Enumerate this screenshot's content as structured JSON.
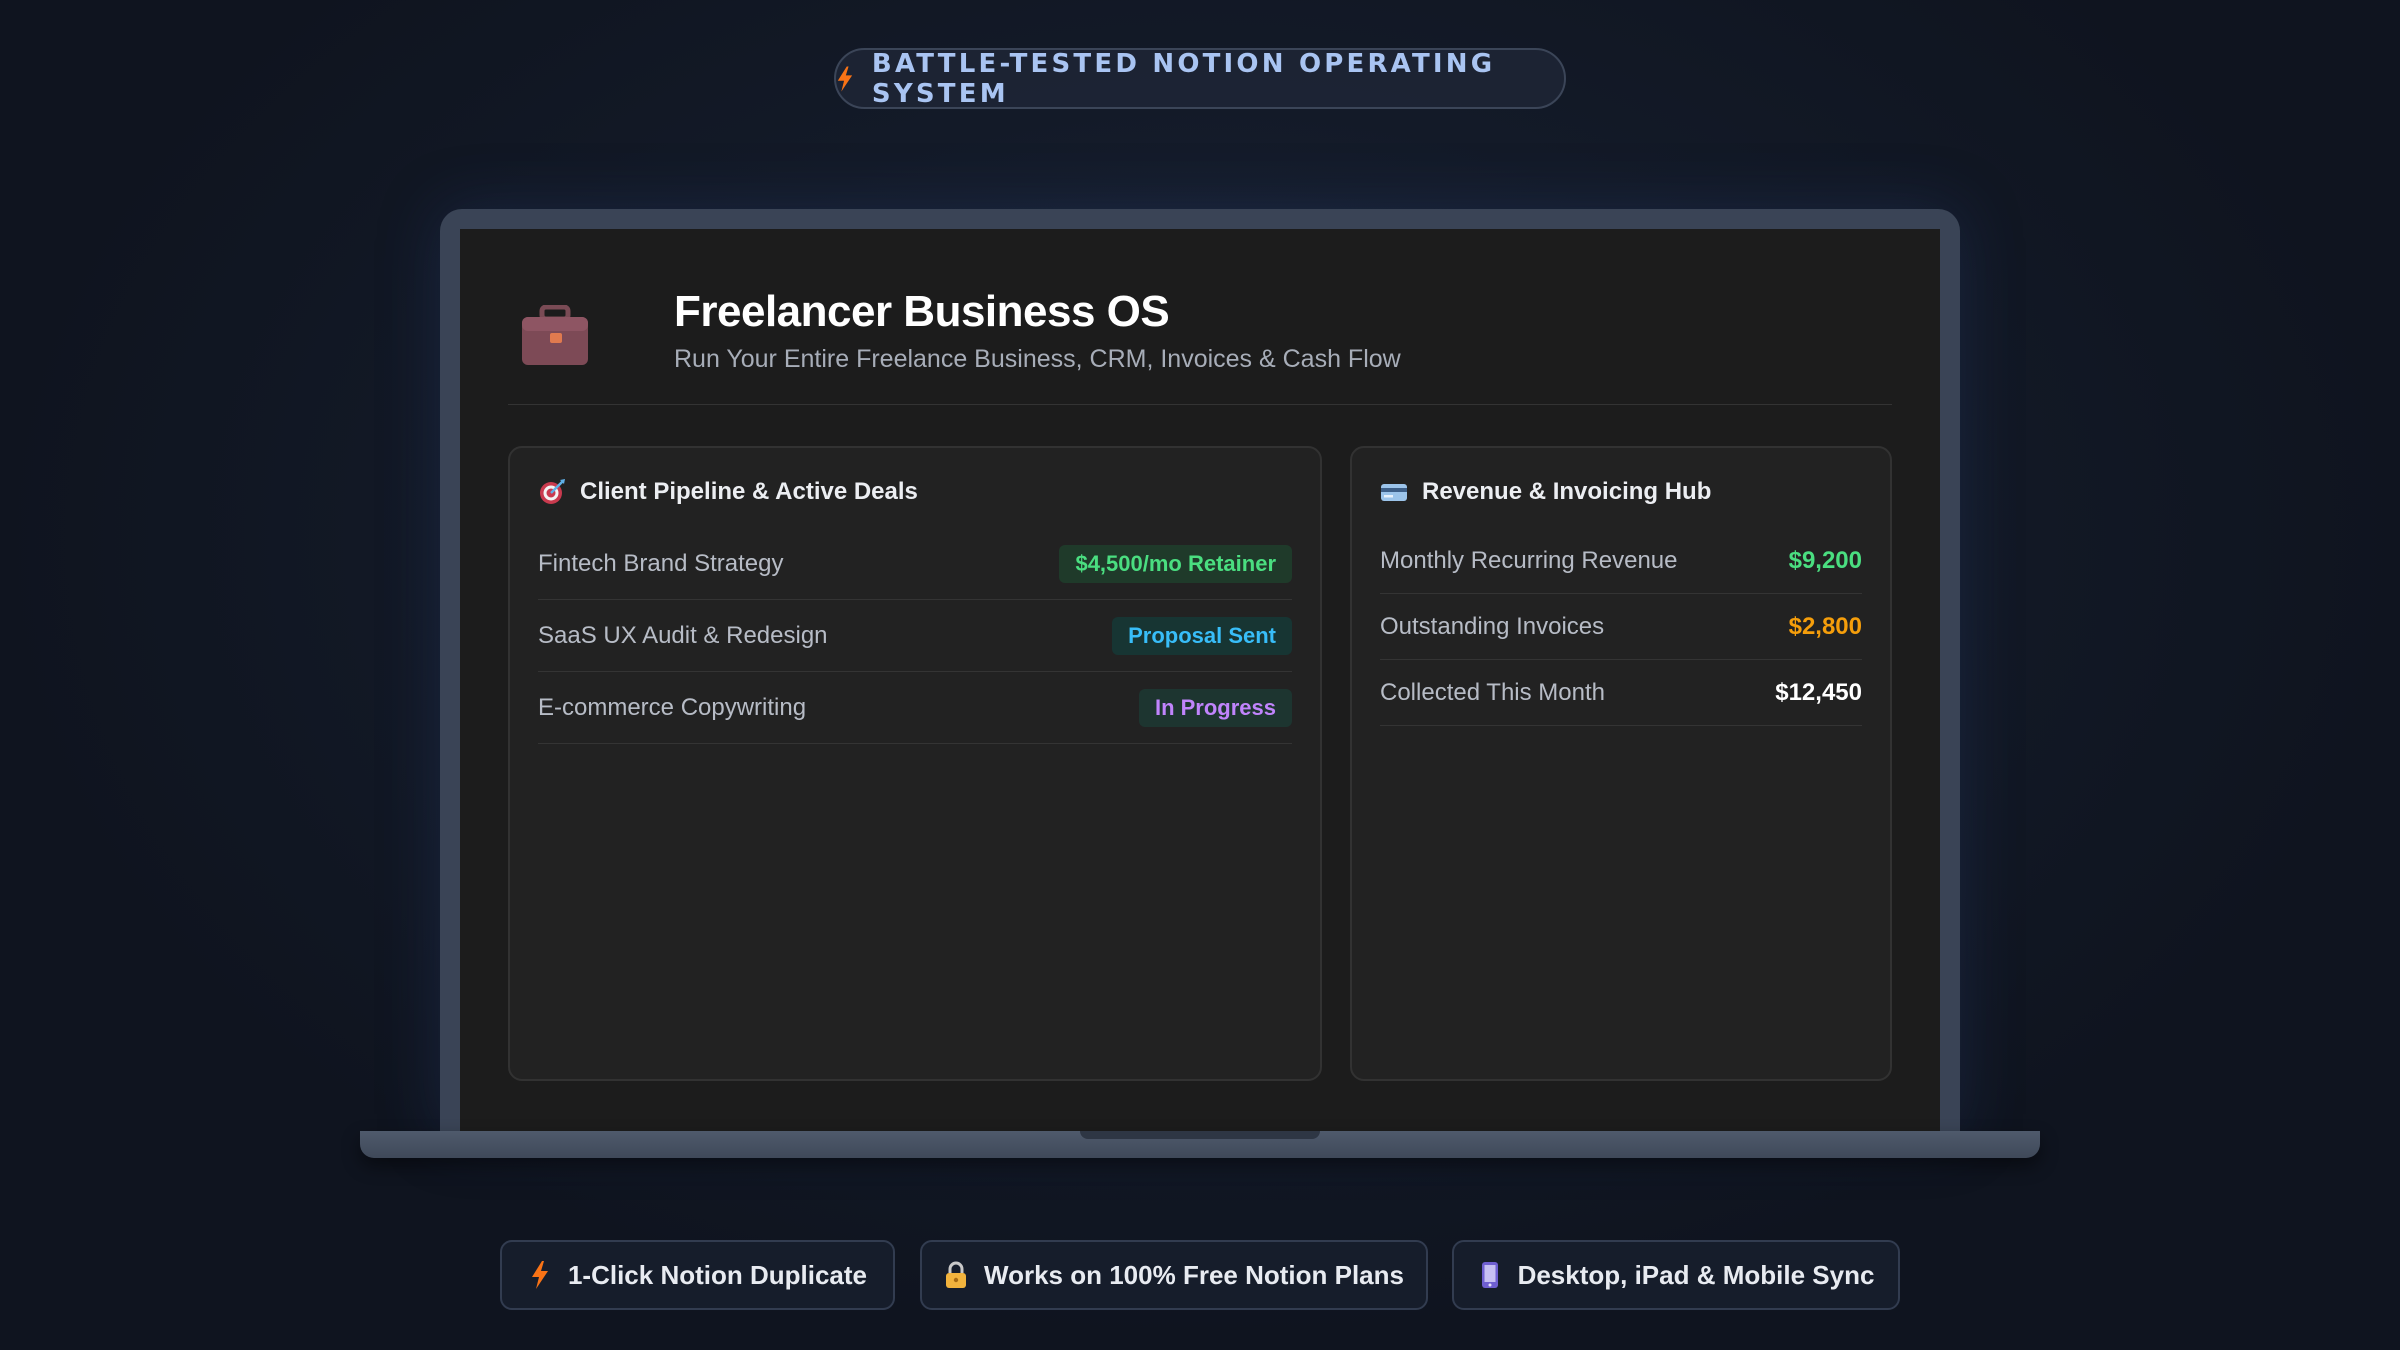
{
  "badge": {
    "text": "BATTLE-TESTED NOTION OPERATING SYSTEM",
    "icon": "bolt-icon"
  },
  "app": {
    "icon": "briefcase-icon",
    "title": "Freelancer Business OS",
    "subtitle": "Run Your Entire Freelance Business, CRM, Invoices & Cash Flow"
  },
  "pipeline": {
    "icon": "target-icon",
    "title": "Client Pipeline & Active Deals",
    "rows": [
      {
        "name": "Fintech Brand Strategy",
        "status": "$4,500/mo Retainer",
        "color": "#4ade80"
      },
      {
        "name": "SaaS UX Audit & Redesign",
        "status": "Proposal Sent",
        "color": "#38bdf8"
      },
      {
        "name": "E-commerce Copywriting",
        "status": "In Progress",
        "color": "#c084fc"
      }
    ]
  },
  "revenue": {
    "icon": "credit-card-icon",
    "title": "Revenue & Invoicing Hub",
    "rows": [
      {
        "label": "Monthly Recurring Revenue",
        "value": "$9,200",
        "color": "#4ade80"
      },
      {
        "label": "Outstanding Invoices",
        "value": "$2,800",
        "color": "#f59e0b"
      },
      {
        "label": "Collected This Month",
        "value": "$12,450",
        "color": "#ffffff"
      }
    ]
  },
  "features": [
    {
      "icon": "bolt-icon",
      "text": "1-Click Notion Duplicate"
    },
    {
      "icon": "lock-icon",
      "text": "Works on 100% Free Notion Plans"
    },
    {
      "icon": "mobile-phone-icon",
      "text": "Desktop, iPad & Mobile Sync"
    }
  ]
}
